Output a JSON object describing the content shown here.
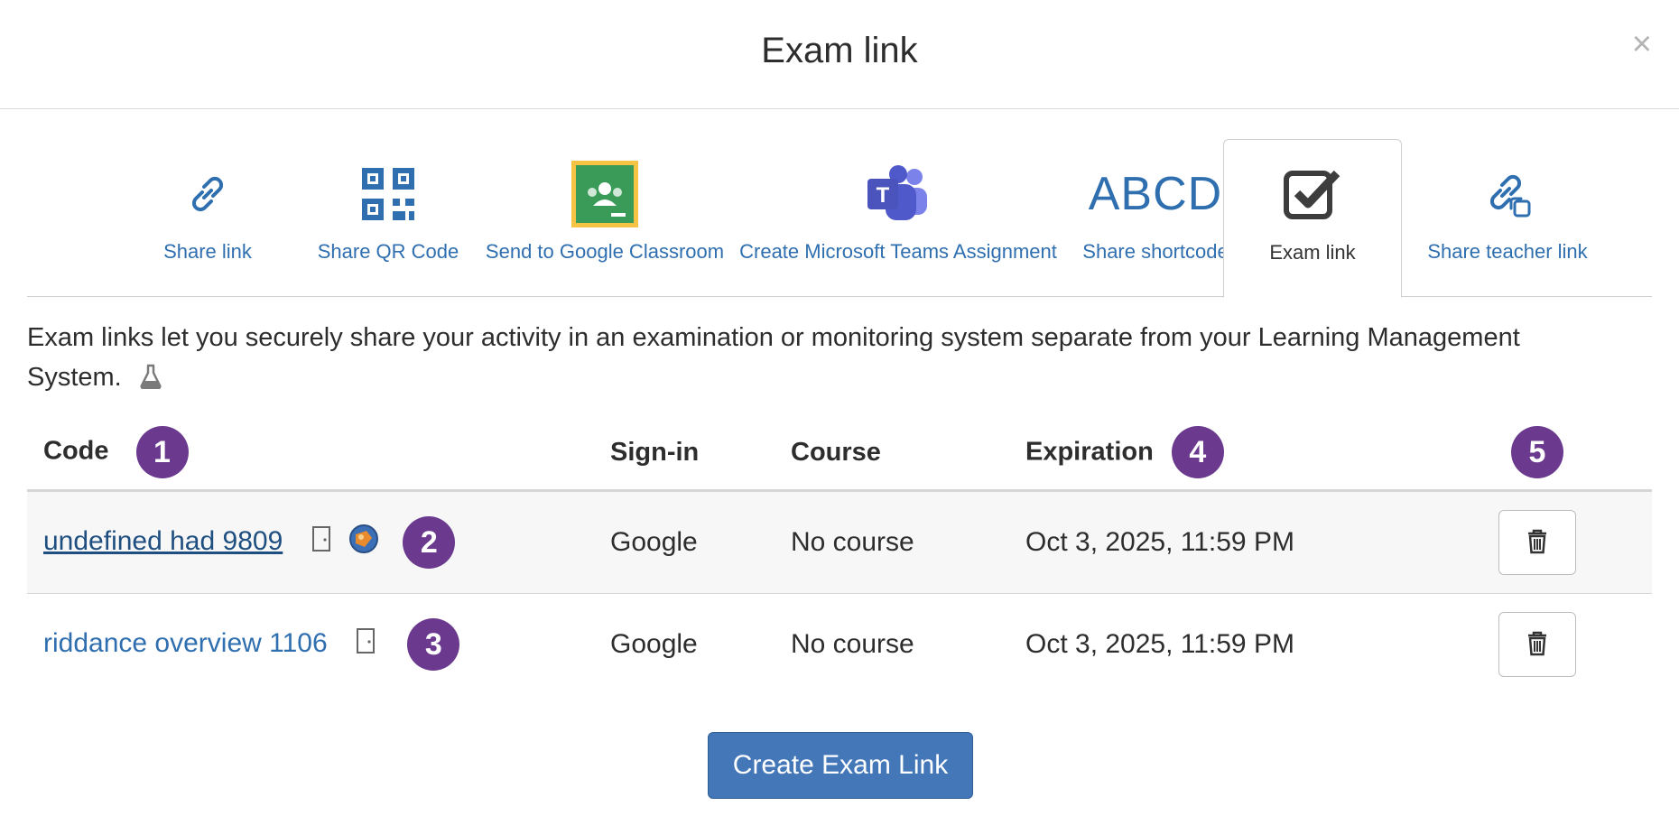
{
  "dialog": {
    "title": "Exam link",
    "close_symbol": "×"
  },
  "tabs": [
    {
      "label": "Share link",
      "icon": "link-icon"
    },
    {
      "label": "Share QR Code",
      "icon": "qr-code-icon"
    },
    {
      "label": "Send to Google Classroom",
      "icon": "google-classroom-icon"
    },
    {
      "label": "Create Microsoft Teams Assignment",
      "icon": "microsoft-teams-icon"
    },
    {
      "label": "Share shortcode",
      "icon_text": "ABCD"
    },
    {
      "label": "Exam link",
      "icon": "checkbox-check-icon",
      "active": true
    },
    {
      "label": "Share teacher link",
      "icon": "teacher-link-icon"
    }
  ],
  "description": "Exam links let you securely share your activity in an examination or monitoring system separate from your Learning Management System.",
  "table": {
    "headers": {
      "code": "Code",
      "signin": "Sign-in",
      "course": "Course",
      "expiration": "Expiration"
    },
    "rows": [
      {
        "code": "undefined had 9809",
        "signin": "Google",
        "course": "No course",
        "expiration": "Oct 3, 2025, 11:59 PM"
      },
      {
        "code": "riddance overview 1106",
        "signin": "Google",
        "course": "No course",
        "expiration": "Oct 3, 2025, 11:59 PM"
      }
    ]
  },
  "badges": {
    "b1": "1",
    "b2": "2",
    "b3": "3",
    "b4": "4",
    "b5": "5"
  },
  "create_button": "Create Exam Link",
  "colors": {
    "accent": "#4477b8",
    "link": "#2f6fb0",
    "badge": "#6b3a8f"
  }
}
